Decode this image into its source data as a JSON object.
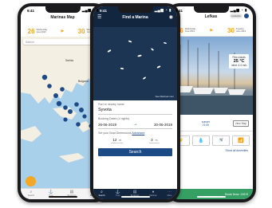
{
  "status": {
    "time": "9:41",
    "signal": "▂▄▆ ◔ ▮"
  },
  "left_phone": {
    "title": "Marinas Map",
    "header_icon": "filter-icon",
    "checkin": {
      "day": "26",
      "weekday": "Wednesday",
      "month": "June 2019"
    },
    "checkout": {
      "day": "30",
      "weekday": "Wednesday",
      "month": "June 2019"
    },
    "search_placeholder": "Search",
    "labels": {
      "serbia": "Serbia",
      "bulgaria": "Bulgaria"
    },
    "tabs": [
      {
        "label": "Search",
        "icon": "search-icon"
      },
      {
        "label": "Trips",
        "icon": "trips-icon"
      },
      {
        "label": "Bookings",
        "icon": "bookings-icon"
      },
      {
        "label": "Marinas",
        "icon": "marker-icon"
      }
    ],
    "colors": {
      "accent": "#f5a623",
      "sea": "#a9d0ea",
      "land": "#f3efe2",
      "pin": "#1c4a86"
    }
  },
  "middle_phone": {
    "title": "Find a Marina",
    "watermark": "Sea Marinas.com",
    "port_label": "Port or nearby name",
    "port_value": "Syvota",
    "dates_label": "Booking Dates (4 nights)",
    "date_from": "26-06-2019",
    "date_to": "30-06-2019",
    "boat_label": "Set your Boat Dimensions",
    "boat_link": "Advanced",
    "length_value": "12",
    "length_unit": "m",
    "beam_value": "3",
    "beam_unit": "m",
    "search_button": "Search",
    "tabs": [
      {
        "label": "Search",
        "icon": "search-icon"
      },
      {
        "label": "Trips",
        "icon": "trips-icon"
      },
      {
        "label": "Bookings",
        "icon": "bookings-icon"
      },
      {
        "label": "Marinas",
        "icon": "marker-icon"
      },
      {
        "label": "More",
        "icon": "more-icon"
      }
    ],
    "colors": {
      "navy": "#13263f",
      "sea": "#1b3553",
      "button": "#1c4a86"
    }
  },
  "right_phone": {
    "title": "Lefkas",
    "toggle_label": "Available",
    "checkin": {
      "day": "26",
      "weekday": "Wednesday",
      "month": "June 2019"
    },
    "checkout": {
      "day": "30",
      "weekday": "Tuesday",
      "month": "June 2019"
    },
    "weather": {
      "condition": "Few clouds",
      "temp": "25 °C",
      "wind": "wind: 4.4 m/s"
    },
    "sunrise_label": "sunset",
    "sunrise_value": "21:09",
    "view_map": "View Map",
    "show_all": "Show all Amenities",
    "book_button": "Book Now: 240 €",
    "amenities": [
      {
        "icon": "electricity-icon",
        "glyph": "⚡"
      },
      {
        "icon": "water-icon",
        "glyph": "💧"
      },
      {
        "icon": "shower-icon",
        "glyph": "🚿"
      },
      {
        "icon": "wifi-icon",
        "glyph": "📶"
      }
    ],
    "colors": {
      "book": "#36a064",
      "accent": "#1c4a86"
    }
  }
}
